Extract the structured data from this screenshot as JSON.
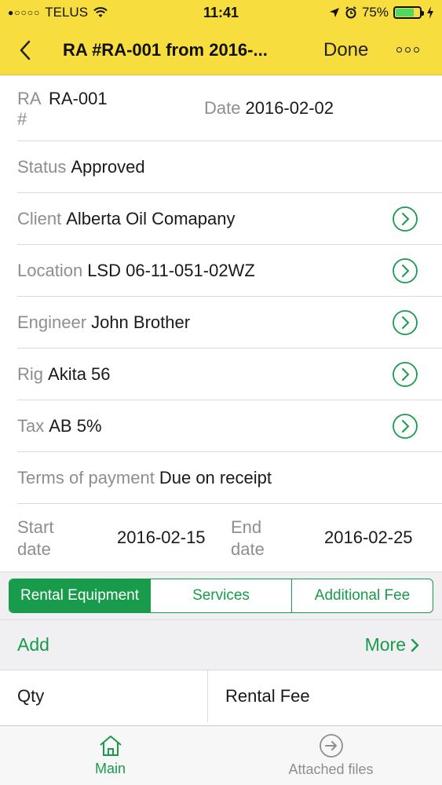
{
  "status_bar": {
    "carrier_dots": "●○○○○",
    "carrier": "TELUS",
    "time": "11:41",
    "battery_percent": "75%",
    "battery_level": 0.75
  },
  "navbar": {
    "title": "RA #RA-001 from 2016-...",
    "done_label": "Done"
  },
  "fields": {
    "ra_label_line1": "RA",
    "ra_label_line2": "#",
    "ra_value": "RA-001",
    "date_label": "Date",
    "date_value": "2016-02-02",
    "status_label": "Status",
    "status_value": "Approved",
    "client_label": "Client",
    "client_value": "Alberta Oil Comapany",
    "location_label": "Location",
    "location_value": "LSD 06-11-051-02WZ",
    "engineer_label": "Engineer",
    "engineer_value": "John Brother",
    "rig_label": "Rig",
    "rig_value": "Akita 56",
    "tax_label": "Tax",
    "tax_value": "AB 5%",
    "terms_label": "Terms of payment",
    "terms_value": "Due on receipt",
    "start_label_line1": "Start",
    "start_label_line2": "date",
    "start_value": "2016-02-15",
    "end_label_line1": "End",
    "end_label_line2": "date",
    "end_value": "2016-02-25"
  },
  "segments": {
    "items": [
      {
        "label": "Rental Equipment",
        "active": true
      },
      {
        "label": "Services",
        "active": false
      },
      {
        "label": "Additional Fee",
        "active": false
      }
    ]
  },
  "actions": {
    "add_label": "Add",
    "more_label": "More"
  },
  "table": {
    "headers": [
      "Qty",
      "Rental Fee"
    ]
  },
  "tabbar": {
    "tabs": [
      {
        "label": "Main",
        "icon": "home-icon",
        "active": true
      },
      {
        "label": "Attached files",
        "icon": "arrow-circle-icon",
        "active": false
      }
    ]
  },
  "colors": {
    "header_yellow": "#f7dd3d",
    "accent_green": "#189b4a"
  }
}
